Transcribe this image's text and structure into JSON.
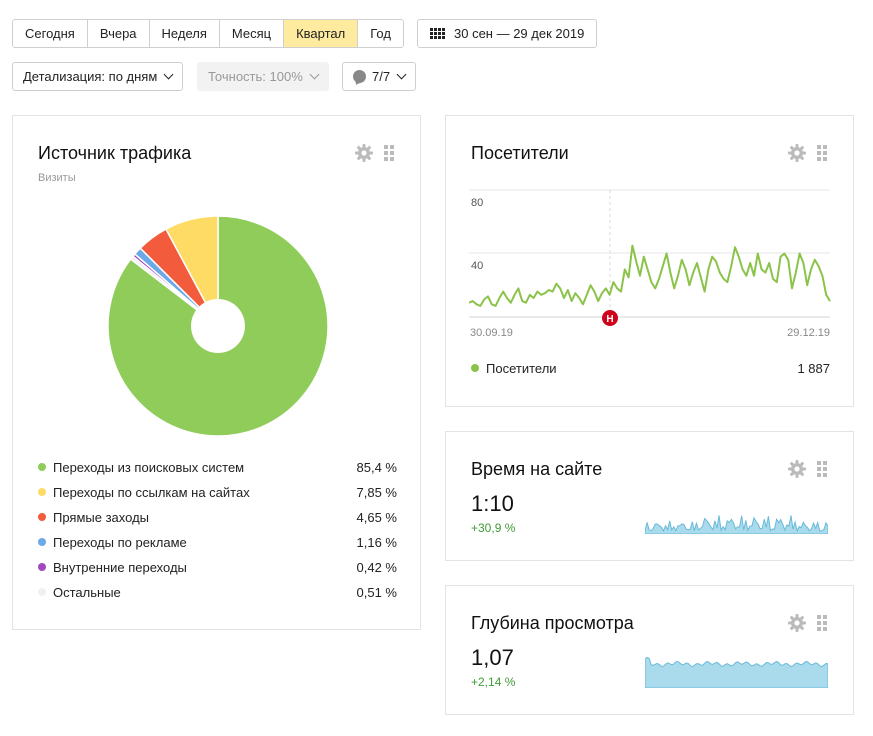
{
  "toolbar": {
    "periods": [
      {
        "label": "Сегодня",
        "active": false
      },
      {
        "label": "Вчера",
        "active": false
      },
      {
        "label": "Неделя",
        "active": false
      },
      {
        "label": "Месяц",
        "active": false
      },
      {
        "label": "Квартал",
        "active": true
      },
      {
        "label": "Год",
        "active": false
      }
    ],
    "date_range": "30 сен — 29 дек 2019",
    "detail_label": "Детализация: по дням",
    "accuracy_label": "Точность: 100%",
    "segments_label": "7/7"
  },
  "colors": {
    "accent_active": "#ffeba0",
    "search": "#8fcc5a",
    "links": "#fddb64",
    "direct": "#f25b3c",
    "ads": "#6baae6",
    "internal": "#a248c0",
    "other": "#f0f0f0",
    "visitors_line": "#8bc34a",
    "area_fill": "#a9dbec",
    "delta_positive": "#3f9c35"
  },
  "traffic": {
    "title": "Источник трафика",
    "subtitle": "Визиты",
    "legend": [
      {
        "label": "Переходы из поисковых систем",
        "value": "85,4 %",
        "share": 85.4,
        "color": "#8fcc5a"
      },
      {
        "label": "Переходы по ссылкам на сайтах",
        "value": "7,85 %",
        "share": 7.85,
        "color": "#fddb64"
      },
      {
        "label": "Прямые заходы",
        "value": "4,65 %",
        "share": 4.65,
        "color": "#f25b3c"
      },
      {
        "label": "Переходы по рекламе",
        "value": "1,16 %",
        "share": 1.16,
        "color": "#6baae6"
      },
      {
        "label": "Внутренние переходы",
        "value": "0,42 %",
        "share": 0.42,
        "color": "#a248c0"
      },
      {
        "label": "Остальные",
        "value": "0,51 %",
        "share": 0.51,
        "color": "#f0f0f0"
      }
    ]
  },
  "visitors": {
    "title": "Посетители",
    "y_tick_80": "80",
    "y_tick_40": "40",
    "x_start": "30.09.19",
    "x_end": "29.12.19",
    "marker": "Н",
    "series_label": "Посетители",
    "total": "1 887"
  },
  "time_on_site": {
    "title": "Время на сайте",
    "value": "1:10",
    "delta": "+30,9 %"
  },
  "depth": {
    "title": "Глубина просмотра",
    "value": "1,07",
    "delta": "+2,14 %"
  },
  "chart_data": {
    "type": "line",
    "series": [
      {
        "name": "Посетители",
        "values": [
          9,
          10,
          8,
          7,
          11,
          13,
          8,
          7,
          12,
          16,
          12,
          9,
          14,
          18,
          10,
          9,
          14,
          12,
          16,
          14,
          15,
          17,
          16,
          21,
          18,
          12,
          17,
          10,
          15,
          12,
          8,
          14,
          20,
          16,
          10,
          15,
          18,
          14,
          22,
          18,
          16,
          30,
          25,
          45,
          35,
          26,
          38,
          30,
          22,
          18,
          24,
          32,
          40,
          28,
          18,
          26,
          36,
          30,
          20,
          28,
          34,
          25,
          16,
          30,
          38,
          35,
          28,
          24,
          22,
          32,
          44,
          38,
          30,
          26,
          34,
          26,
          40,
          30,
          28,
          34,
          24,
          22,
          38,
          40,
          36,
          18,
          28,
          40,
          34,
          20,
          30,
          36,
          32,
          26,
          14,
          10
        ]
      }
    ],
    "x_start": "30.09.19",
    "x_end": "29.12.19",
    "ylim": [
      0,
      100
    ]
  }
}
